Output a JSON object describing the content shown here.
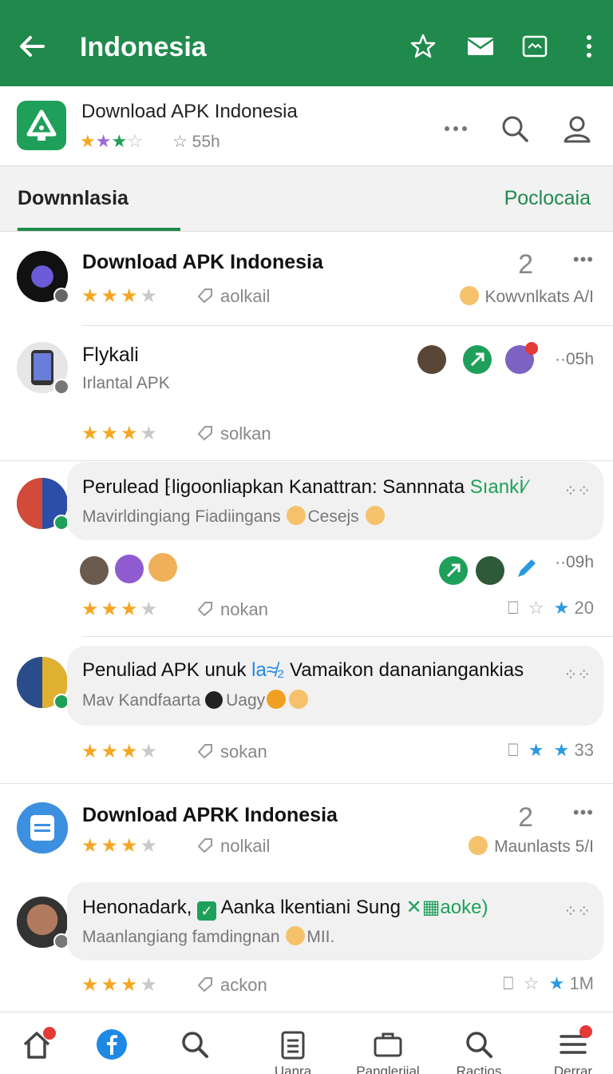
{
  "appbar": {
    "title": "Indonesia",
    "back_icon": "arrow-left-icon",
    "actions": [
      "star-icon",
      "mail-icon",
      "image-icon",
      "more-vertical-icon"
    ]
  },
  "app_header": {
    "name": "Download APK Indonesia",
    "rating_stars": "★★★☆",
    "meta": "☆ 55h",
    "icons": [
      "more-horizontal-icon",
      "search-icon",
      "profile-icon"
    ]
  },
  "tabs": {
    "left": "Downnlasia",
    "right": "Poclocaia"
  },
  "feed": {
    "item1": {
      "title": "Download APK Indonesia",
      "tag": "aolkail",
      "count": "2",
      "right_meta": "Kowvnlkats A/I"
    },
    "item2": {
      "title": "Flykali",
      "subtitle": "Irlantal APK",
      "time": "··05h",
      "tag": "solkan"
    },
    "post1": {
      "title_pre": "Perulead ⁅ligoonliapkan Kanattran: Sannnata ",
      "title_hl": "Sıankİ⁄",
      "subtitle_pre": "Mavirldingiang Fiadiingans ",
      "subtitle_post": "Cesejs ",
      "time": "··09h",
      "tag": "nokan",
      "react_count": "20"
    },
    "post2": {
      "title_pre": "Penuliad APK unuk ",
      "title_hl": "la≉₂",
      "title_post": " Vamaikon dananiangankias",
      "subtitle_pre": "Mav Kandfaarta ",
      "subtitle_post": "Uagy",
      "tag": "sokan",
      "react_count": "33"
    },
    "item3": {
      "title": "Download APRK Indonesia",
      "tag": "nolkail",
      "count": "2",
      "right_meta": "Maunlasts 5/I"
    },
    "post3": {
      "title_pre": "Henonadark, ",
      "title_mid": " Aanka lkentiani Sung ",
      "title_hl": "✕▦aoke)",
      "subtitle_pre": "Maanlangiang famdingnan ",
      "subtitle_post": "MII.",
      "tag": "ackon",
      "react_count": "1M"
    }
  },
  "bottom_nav": [
    {
      "icon": "home-icon",
      "label": ""
    },
    {
      "icon": "facebook-icon",
      "label": ""
    },
    {
      "icon": "search-icon",
      "label": ""
    },
    {
      "icon": "clipboard-icon",
      "label": "Uanra"
    },
    {
      "icon": "briefcase-icon",
      "label": "Panglerjial"
    },
    {
      "icon": "search-icon",
      "label": "Ractios"
    },
    {
      "icon": "menu-icon",
      "label": "Derrar"
    }
  ],
  "colors": {
    "brand_green": "#1f8a4c",
    "star_gold": "#f5a623",
    "link_blue": "#1e88e5",
    "badge_red": "#e53935"
  }
}
